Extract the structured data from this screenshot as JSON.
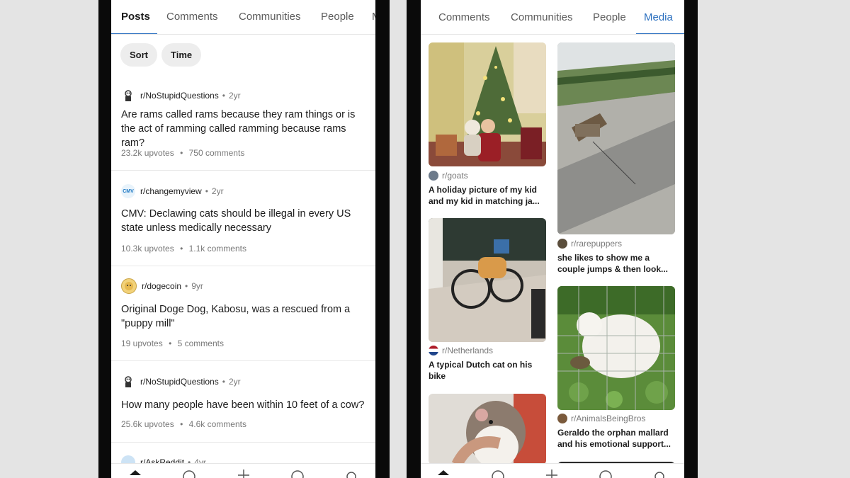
{
  "left": {
    "tabs": [
      {
        "label": "Posts",
        "active": true
      },
      {
        "label": "Comments",
        "active": false
      },
      {
        "label": "Communities",
        "active": false
      },
      {
        "label": "People",
        "active": false
      },
      {
        "label": "M",
        "active": false
      }
    ],
    "chips": {
      "sort": "Sort",
      "time": "Time"
    },
    "posts": [
      {
        "subreddit": "r/NoStupidQuestions",
        "age": "2yr",
        "title": "Are rams called rams because they ram things or is the act of ramming called ramming because rams ram?",
        "upvotes": "23.2k upvotes",
        "comments": "750 comments"
      },
      {
        "subreddit": "r/changemyview",
        "age": "2yr",
        "title": "CMV: Declawing cats should be illegal in every US state unless medically necessary",
        "upvotes": "10.3k upvotes",
        "comments": "1.1k comments"
      },
      {
        "subreddit": "r/dogecoin",
        "age": "9yr",
        "title": "Original Doge Dog, Kabosu, was a rescued from a \"puppy mill\"",
        "upvotes": "19 upvotes",
        "comments": "5 comments"
      },
      {
        "subreddit": "r/NoStupidQuestions",
        "age": "2yr",
        "title": "How many people have been within 10 feet of a cow?",
        "upvotes": "25.6k upvotes",
        "comments": "4.6k comments"
      },
      {
        "subreddit": "r/AskReddit",
        "age": "4yr"
      }
    ],
    "avatar_labels": {
      "cmv": "CMV"
    }
  },
  "right": {
    "tabs": [
      {
        "label": "Comments",
        "active": false
      },
      {
        "label": "Communities",
        "active": false
      },
      {
        "label": "People",
        "active": false
      },
      {
        "label": "Media",
        "active": true
      }
    ],
    "media": [
      {
        "subreddit": "r/goats",
        "caption": "A holiday picture of my kid and my kid in matching ja..."
      },
      {
        "subreddit": "r/rarepuppers",
        "caption": "she likes to show me a couple jumps & then look..."
      },
      {
        "subreddit": "r/Netherlands",
        "caption": "A typical Dutch cat on his bike"
      },
      {
        "subreddit": "r/AnimalsBeingBros",
        "caption": "Geraldo the orphan mallard and his emotional support..."
      }
    ]
  },
  "colors": {
    "accent": "#2a6fbf",
    "meta_text": "#787878",
    "chip_bg": "#ededed"
  },
  "icons": [
    "home-icon",
    "communities-icon",
    "create-icon",
    "chat-icon",
    "inbox-icon"
  ]
}
